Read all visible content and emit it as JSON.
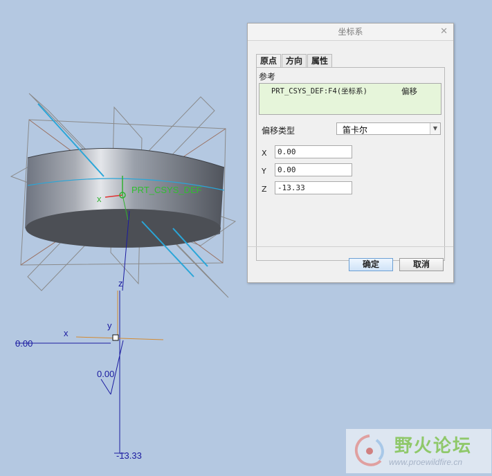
{
  "viewport": {
    "csys_label": "PRT_CSYS_DEF",
    "axis_x": "x",
    "axis_y": "y",
    "axis_z": "z",
    "dim_x": "0.00",
    "dim_y": "0.00",
    "dim_z": "-13.33"
  },
  "dialog": {
    "title": "坐标系",
    "close_icon": "close-icon",
    "tabs": [
      {
        "label": "原点",
        "active": true
      },
      {
        "label": "方向",
        "active": false
      },
      {
        "label": "属性",
        "active": false
      }
    ],
    "reference_label": "参考",
    "reference": {
      "item": "PRT_CSYS_DEF:F4(坐标系)",
      "type": "偏移"
    },
    "offset_type_label": "偏移类型",
    "offset_type_value": "笛卡尔",
    "coords": [
      {
        "label": "X",
        "value": "0.00"
      },
      {
        "label": "Y",
        "value": "0.00"
      },
      {
        "label": "Z",
        "value": "-13.33"
      }
    ],
    "ok_label": "确定",
    "cancel_label": "取消"
  },
  "watermark": {
    "title": "野火论坛",
    "url": "www.proewildfire.cn"
  },
  "colors": {
    "background": "#b4c8e1",
    "reference_box": "#e6f5da",
    "csys_label": "#2fbf2f",
    "dimension": "#1a1aa0",
    "watermark_green": "#8fc86a"
  }
}
